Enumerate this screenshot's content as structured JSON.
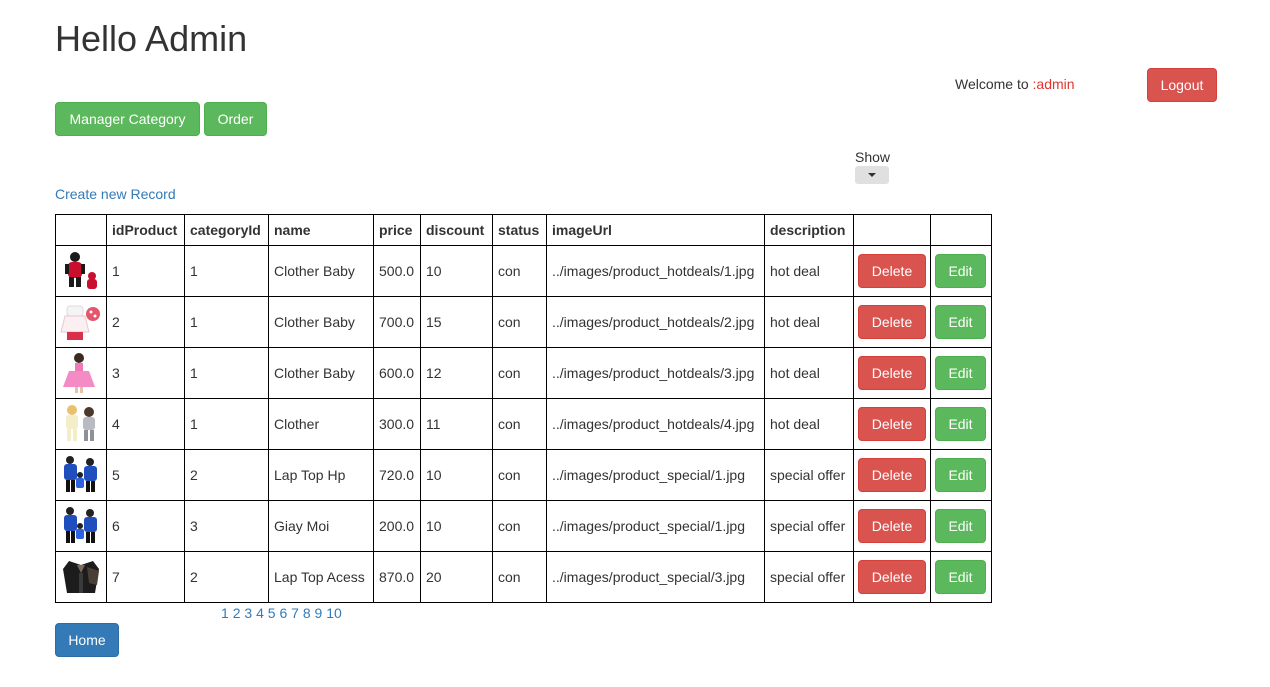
{
  "header": {
    "title": "Hello Admin",
    "welcome_text": "Welcome to ",
    "welcome_user": ":admin",
    "logout_label": "Logout"
  },
  "nav": {
    "manager_category_label": "Manager Category",
    "order_label": "Order"
  },
  "show": {
    "label": "Show"
  },
  "create_link": "Create new Record",
  "table": {
    "columns": [
      "",
      "idProduct",
      "categoryId",
      "name",
      "price",
      "discount",
      "status",
      "imageUrl",
      "description",
      "",
      ""
    ],
    "rows": [
      {
        "idProduct": "1",
        "categoryId": "1",
        "name": "Clother Baby",
        "price": "500.0",
        "discount": "10",
        "status": "con",
        "imageUrl": "../images/product_hotdeals/1.jpg",
        "description": "hot deal",
        "thumb": "red-baby-outfit"
      },
      {
        "idProduct": "2",
        "categoryId": "1",
        "name": "Clother Baby",
        "price": "700.0",
        "discount": "15",
        "status": "con",
        "imageUrl": "../images/product_hotdeals/2.jpg",
        "description": "hot deal",
        "thumb": "white-red-dress"
      },
      {
        "idProduct": "3",
        "categoryId": "1",
        "name": "Clother Baby",
        "price": "600.0",
        "discount": "12",
        "status": "con",
        "imageUrl": "../images/product_hotdeals/3.jpg",
        "description": "hot deal",
        "thumb": "pink-dress"
      },
      {
        "idProduct": "4",
        "categoryId": "1",
        "name": "Clother",
        "price": "300.0",
        "discount": "11",
        "status": "con",
        "imageUrl": "../images/product_hotdeals/4.jpg",
        "description": "hot deal",
        "thumb": "kids-pair"
      },
      {
        "idProduct": "5",
        "categoryId": "2",
        "name": "Lap Top Hp",
        "price": "720.0",
        "discount": "10",
        "status": "con",
        "imageUrl": "../images/product_special/1.jpg",
        "description": "special offer",
        "thumb": "blue-family"
      },
      {
        "idProduct": "6",
        "categoryId": "3",
        "name": "Giay Moi",
        "price": "200.0",
        "discount": "10",
        "status": "con",
        "imageUrl": "../images/product_special/1.jpg",
        "description": "special offer",
        "thumb": "blue-family"
      },
      {
        "idProduct": "7",
        "categoryId": "2",
        "name": "Lap Top Acess",
        "price": "870.0",
        "discount": "20",
        "status": "con",
        "imageUrl": "../images/product_special/3.jpg",
        "description": "special offer",
        "thumb": "black-jackets"
      }
    ],
    "delete_label": "Delete",
    "edit_label": "Edit"
  },
  "pagination": [
    "1",
    "2",
    "3",
    "4",
    "5",
    "6",
    "7",
    "8",
    "9",
    "10"
  ],
  "home_label": "Home",
  "colors": {
    "danger": "#d9534f",
    "success": "#5cb85c",
    "primary": "#337ab7",
    "admin_name": "#e3342f"
  }
}
